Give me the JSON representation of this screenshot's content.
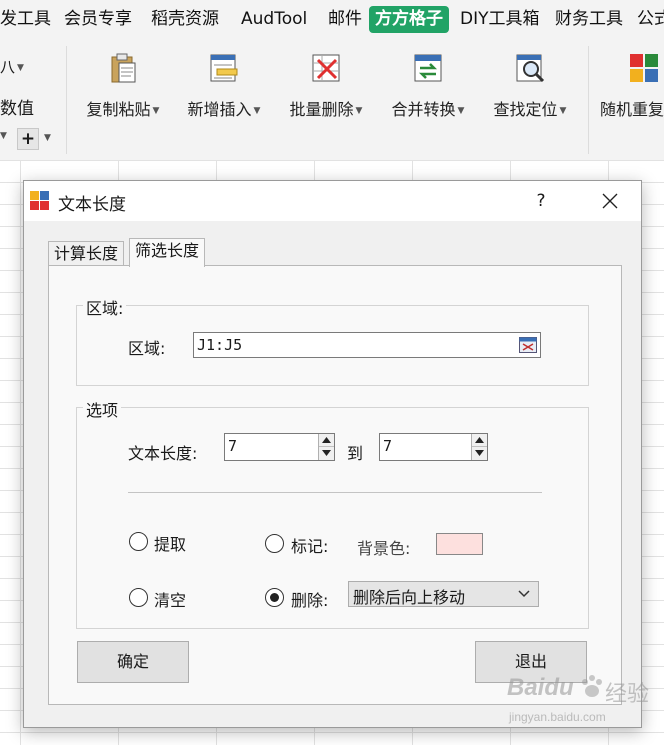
{
  "ribbon_tabs": [
    "发工具",
    "会员专享",
    "稻壳资源",
    "AudTool",
    "邮件",
    "方方格子",
    "DIY工具箱",
    "财务工具",
    "公式"
  ],
  "active_tab": "方方格子",
  "ribbon_left": {
    "top_label": "八",
    "numeric_label": "数值"
  },
  "ribbon_buttons": [
    "复制粘贴",
    "新增插入",
    "批量删除",
    "合并转换",
    "查找定位",
    "随机重复"
  ],
  "dialog": {
    "title": "文本长度",
    "help": "?",
    "tabs": [
      "计算长度",
      "筛选长度"
    ],
    "active_tab": "筛选长度",
    "region_group": {
      "title": "区域:",
      "label": "区域:",
      "value": "J1:J5"
    },
    "options_group": {
      "title": "选项",
      "length_label": "文本长度:",
      "length_from": "7",
      "to_label": "到",
      "length_to": "7",
      "extract_label": "提取",
      "mark_label": "标记:",
      "bg_color_label": "背景色:",
      "bg_color": "#fde0de",
      "clear_label": "清空",
      "delete_label": "删除:",
      "delete_option": "删除后向上移动",
      "selected_option": "删除"
    },
    "ok_button": "确定",
    "exit_button": "退出"
  },
  "colors": {
    "accent_green": "#21a366",
    "ribbon_bg": "#f3f3f3",
    "dialog_bg": "#f0f0f0"
  },
  "watermark": {
    "brand": "Baidu",
    "suffix": "经验",
    "url": "jingyan.baidu.com"
  }
}
